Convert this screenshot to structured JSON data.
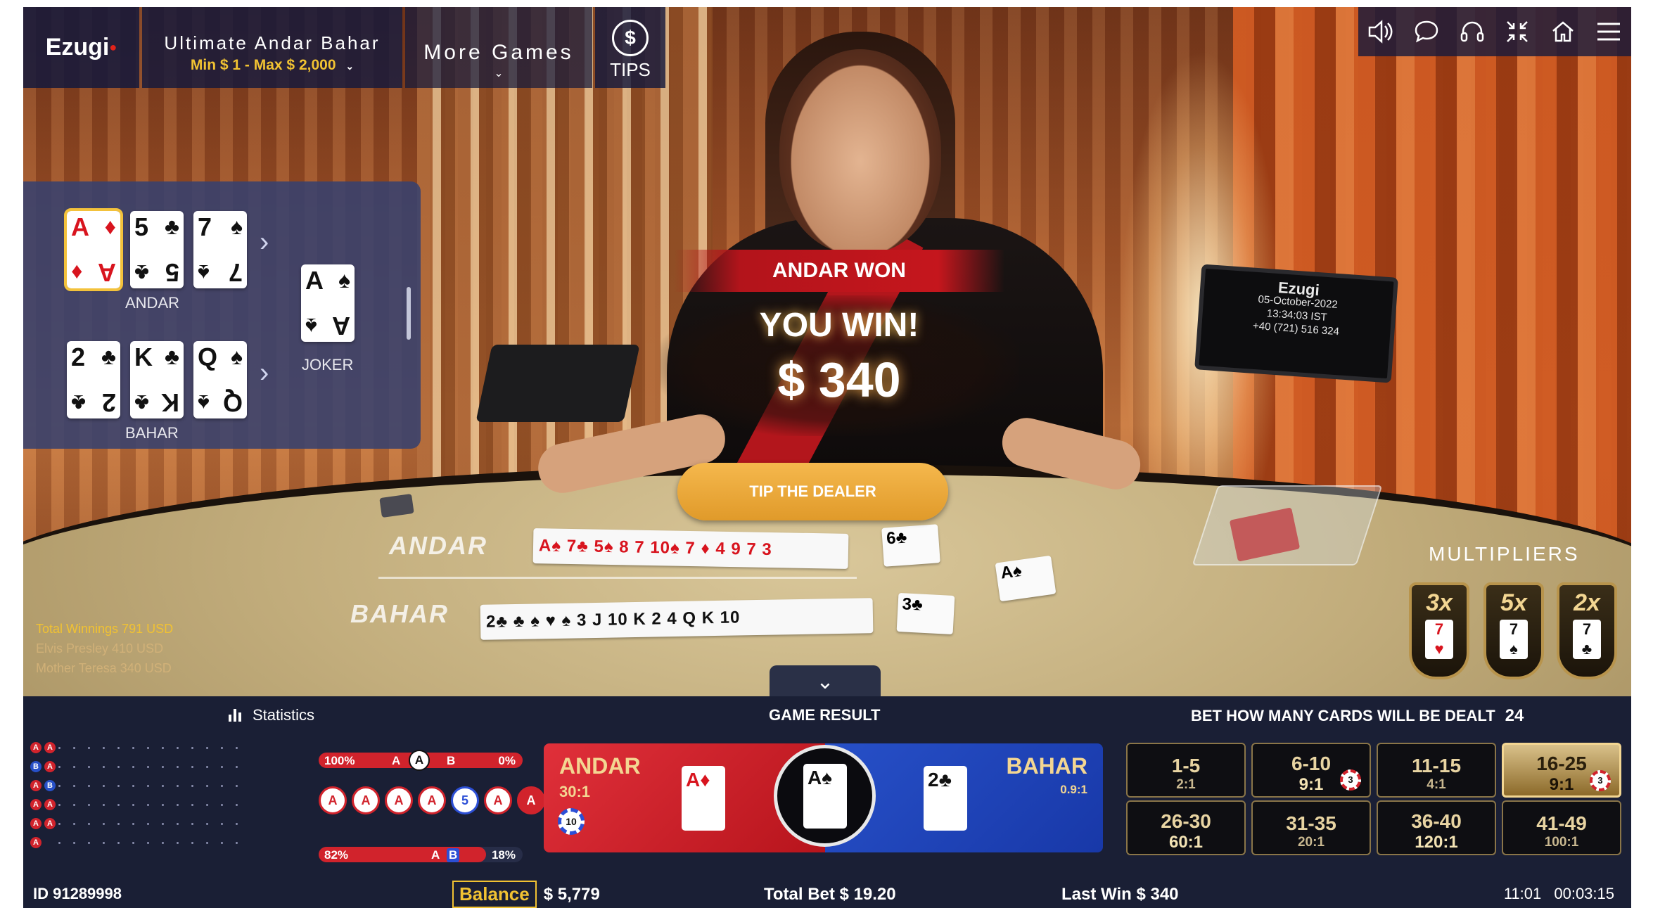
{
  "topbar": {
    "logo": "Ezugi",
    "game_title": "Ultimate Andar Bahar",
    "limits": "Min $ 1 - Max $ 2,000",
    "more_games": "More Games",
    "tips_symbol": "$",
    "tips_label": "TIPS"
  },
  "icons": [
    "speaker-icon",
    "chat-icon",
    "headset-icon",
    "collapse-icon",
    "home-icon",
    "menu-icon"
  ],
  "panel": {
    "andar_label": "ANDAR",
    "bahar_label": "BAHAR",
    "joker_label": "JOKER",
    "andar_cards": [
      {
        "rank": "A",
        "suit": "♦",
        "red": true
      },
      {
        "rank": "5",
        "suit": "♣",
        "red": false
      },
      {
        "rank": "7",
        "suit": "♠",
        "red": false
      }
    ],
    "bahar_cards": [
      {
        "rank": "2",
        "suit": "♣",
        "red": false
      },
      {
        "rank": "K",
        "suit": "♣",
        "red": false
      },
      {
        "rank": "Q",
        "suit": "♠",
        "red": false
      }
    ],
    "joker_card": {
      "rank": "A",
      "suit": "♠",
      "red": false
    }
  },
  "overlay": {
    "banner": "ANDAR WON",
    "title": "YOU WIN!",
    "amount": "$ 340",
    "tip_button": "TIP THE DEALER"
  },
  "monitor": {
    "brand": "Ezugi",
    "date": "05-October-2022",
    "time": "13:34:03 IST",
    "phone": "+40 (721) 516 324"
  },
  "felt": {
    "andar": "ANDAR",
    "bahar": "BAHAR"
  },
  "multipliers": {
    "title": "MULTIPLIERS",
    "items": [
      {
        "label": "3x",
        "card": "7",
        "suit": "♥",
        "red": true
      },
      {
        "label": "5x",
        "card": "7",
        "suit": "♠",
        "red": false
      },
      {
        "label": "2x",
        "card": "7",
        "suit": "♣",
        "red": false
      }
    ]
  },
  "winners": {
    "title": "Total Winnings  791 USD",
    "rows": [
      "Elvis Presley  410 USD",
      "Mother Teresa  340 USD"
    ]
  },
  "bottom": {
    "statistics": "Statistics",
    "game_result": "GAME RESULT",
    "bet_how": "BET HOW MANY CARDS WILL BE DEALT",
    "bet_how_count": "24"
  },
  "stats": {
    "row1": {
      "left": "100%",
      "a": "A",
      "b": "B",
      "right": "0%",
      "fill": 1.0
    },
    "row2": {
      "left": "82%",
      "a": "A",
      "b": "B",
      "right": "18%",
      "fill": 0.82
    },
    "history": [
      {
        "v": "A",
        "blue": false,
        "solid": false
      },
      {
        "v": "A",
        "blue": false,
        "solid": false
      },
      {
        "v": "A",
        "blue": false,
        "solid": false
      },
      {
        "v": "A",
        "blue": false,
        "solid": false
      },
      {
        "v": "5",
        "blue": true,
        "solid": false
      },
      {
        "v": "A",
        "blue": false,
        "solid": false
      },
      {
        "v": "A",
        "blue": false,
        "solid": true
      }
    ],
    "roadmap": [
      [
        "A",
        "A"
      ],
      [
        "B",
        "A"
      ],
      [
        "A",
        "B"
      ],
      [
        "A",
        "A"
      ],
      [
        "A",
        "A"
      ],
      [
        "A",
        ""
      ]
    ]
  },
  "result": {
    "andar_name": "ANDAR",
    "andar_odds": "30:1",
    "andar_chip": "10",
    "andar_card": {
      "rank": "A",
      "suit": "♦"
    },
    "joker_card": {
      "rank": "A",
      "suit": "♠"
    },
    "bahar_name": "BAHAR",
    "bahar_odds": "0.9:1",
    "bahar_card": {
      "rank": "2",
      "suit": "♣"
    }
  },
  "bets": [
    {
      "range": "1-5",
      "odds": "2:1",
      "bold": false,
      "active": false,
      "chip": ""
    },
    {
      "range": "6-10",
      "odds": "9:1",
      "bold": true,
      "active": false,
      "chip": "3"
    },
    {
      "range": "11-15",
      "odds": "4:1",
      "bold": false,
      "active": false,
      "chip": ""
    },
    {
      "range": "16-25",
      "odds": "9:1",
      "bold": true,
      "active": true,
      "chip": "3"
    },
    {
      "range": "26-30",
      "odds": "60:1",
      "bold": true,
      "active": false,
      "chip": ""
    },
    {
      "range": "31-35",
      "odds": "20:1",
      "bold": false,
      "active": false,
      "chip": ""
    },
    {
      "range": "36-40",
      "odds": "120:1",
      "bold": true,
      "active": false,
      "chip": ""
    },
    {
      "range": "41-49",
      "odds": "100:1",
      "bold": false,
      "active": false,
      "chip": ""
    }
  ],
  "footer": {
    "id": "ID 91289998",
    "balance_label": "Balance",
    "balance": "$ 5,779",
    "total_bet": "Total Bet $ 19.20",
    "last_win": "Last Win $ 340",
    "clock": "11:01",
    "timer": "00:03:15"
  },
  "colors": {
    "andar": "#d1232c",
    "bahar": "#2750c8",
    "gold": "#f1c232",
    "panel": "#1a1f35"
  }
}
